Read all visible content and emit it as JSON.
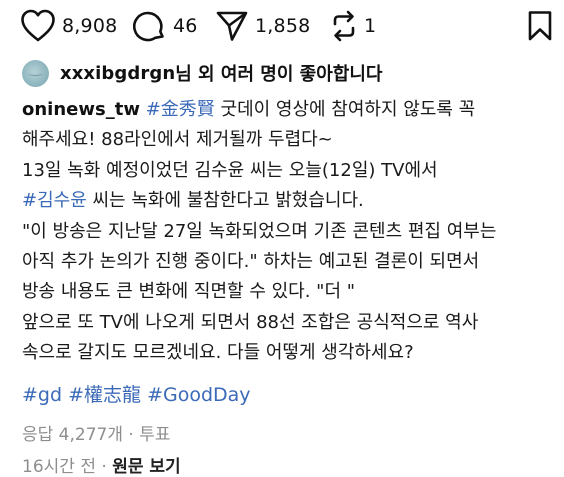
{
  "actions": {
    "likes": "8,908",
    "comments": "46",
    "shares": "1,858",
    "reposts": "1"
  },
  "liked_by": {
    "username": "xxxibgdrgn",
    "suffix": "님 외 여러 명이 좋아합니다"
  },
  "caption": {
    "author": "oninews_tw",
    "line1_tag": "#金秀賢",
    "line1_text": " 굿데이 영상에 참여하지 않도록 꼭",
    "line2": "해주세요! 88라인에서 제거될까 두렵다~",
    "line3": "13일 녹화 예정이었던 김수윤 씨는 오늘(12일) TV에서",
    "line4_tag": "#김수윤",
    "line4_text": " 씨는 녹화에 불참한다고 밝혔습니다.",
    "line5": "\"이 방송은 지난달 27일 녹화되었으며 기존 콘텐츠 편집 여부는",
    "line6": "아직 추가 논의가 진행 중이다.\" 하차는 예고된 결론이 되면서",
    "line7": "방송 내용도 큰 변화에 직면할 수 있다. \"더 \"",
    "line8": "앞으로 또 TV에 나오게 되면서 88선 조합은 공식적으로 역사",
    "line9": "속으로 갈지도 모르겠네요. 다들 어떻게 생각하세요?"
  },
  "hashtags": [
    "#gd",
    "#權志龍",
    "#GoodDay"
  ],
  "replies": {
    "text": "응답 4,277개",
    "separator": " · ",
    "vote": "투표"
  },
  "meta": {
    "time": "16시간 전",
    "separator": " · ",
    "view_original": "원문 보기"
  }
}
